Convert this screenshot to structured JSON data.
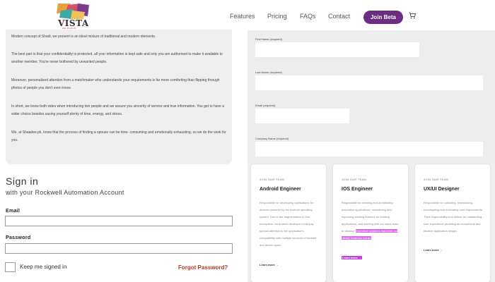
{
  "header": {
    "logo": {
      "text": "VISTA",
      "subtext": "WE PLUGIN"
    },
    "nav": [
      "Features",
      "Pricing",
      "FAQs",
      "Contact"
    ],
    "join_button": "Join Beta",
    "cart_icon": "cart-icon",
    "accent_color": "#6b2c82"
  },
  "about": {
    "paragraphs": [
      "Modern concept of Shadi, we present is an ideal mixture of traditional and modern elements.",
      "The best part is that your confidentiality is protected, all your information is kept safe and only you are authorised to make it available to another member. You're never bothered by unwanted people.",
      "Moreover, personalized attention from a matchmaker who understands your requirements is far more comforting than flipping through photos of people you don't even know.",
      "In short, we know both sides when introducing two people and we assure you sincerity of service and true information. You get to have a wider choice besides saving yourself plenty of time, energy, and stress.",
      "We, at Shaadee.pk, know that the process of finding a spouse can be time- consuming and emotionally exhausting, so we do the work for you."
    ]
  },
  "signin": {
    "title": "Sign in",
    "subtitle": "with your Rockwell Automation Account",
    "email_label": "Email",
    "email_value": "",
    "password_label": "Password",
    "password_value": "",
    "remember_label": "Keep me signed in",
    "forgot_label": "Forgot Password?"
  },
  "form": {
    "fields": [
      {
        "label": "First Name (required)",
        "value": ""
      },
      {
        "label": "Last Name (required)",
        "value": ""
      },
      {
        "label": "Email (required)",
        "value": ""
      },
      {
        "label": "Company Name (required)",
        "value": ""
      }
    ]
  },
  "jobs": {
    "cards": [
      {
        "eyebrow": "JOIN OUR TEAM",
        "title": "Android Engineer",
        "desc_before": "Responsible for developing applications for devices powered by the Android operating system. Due to the fragmentation of this ecosystem, an Android developer must pay special attention to the application's compatibility with multiple versions of Android and device types.",
        "desc_highlight": "",
        "desc_after": "",
        "link": "Learn more →",
        "link_highlight": false
      },
      {
        "eyebrow": "JOIN OUR TEAM",
        "title": "IOS Engineer",
        "desc_before": "Responsible for creating and architecting innovative applications, maintaining and improving existing features on existing applications, and working with our sales team to develop ",
        "desc_highlight": "innovative solutions that meet our clients' business needs.",
        "desc_after": "",
        "link": "Learn more →",
        "link_highlight": true
      },
      {
        "eyebrow": "JOIN OUR TEAM",
        "title": "UX/UI Designer",
        "desc_before": "Responsible for collecting, researching, investigating and evaluating user requirements. Their responsibility is to deliver an outstanding user experience providing an exceptional and intuitive application design.",
        "desc_highlight": "",
        "desc_after": "",
        "link": "Learn more →",
        "link_highlight": false
      }
    ],
    "highlight_color": "#d86af0"
  }
}
